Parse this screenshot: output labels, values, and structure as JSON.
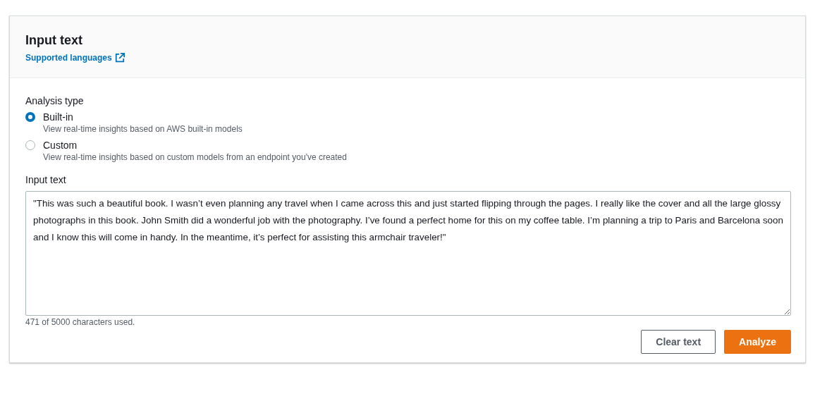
{
  "header": {
    "title": "Input text",
    "link": "Supported languages"
  },
  "analysis_type": {
    "label": "Analysis type",
    "options": [
      {
        "label": "Built-in",
        "description": "View real-time insights based on AWS built-in models",
        "selected": true
      },
      {
        "label": "Custom",
        "description": "View real-time insights based on custom models from an endpoint you've created",
        "selected": false
      }
    ]
  },
  "input": {
    "label": "Input text",
    "value": "\"This was such a beautiful book. I wasn’t even planning any travel when I came across this and just started flipping through the pages. I really like the cover and all the large glossy photographs in this book. John Smith did a wonderful job with the photography. I’ve found a perfect home for this on my coffee table. I’m planning a trip to Paris and Barcelona soon and I know this will come in handy. In the meantime, it’s perfect for assisting this armchair traveler!\"",
    "counter": "471 of 5000 characters used."
  },
  "buttons": [
    {
      "label": "Clear text",
      "kind": "secondary"
    },
    {
      "label": "Analyze",
      "kind": "primary"
    }
  ]
}
